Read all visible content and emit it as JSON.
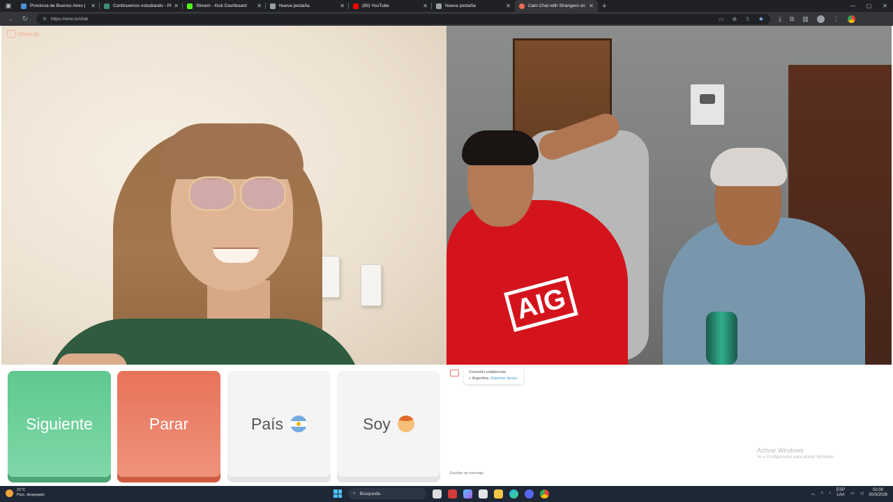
{
  "browser": {
    "tabs": [
      {
        "title": "Provincia de Buenos Aires |",
        "favicon_color": "#4a90d9",
        "active": false
      },
      {
        "title": "Continuemos estudiando - Plataf",
        "favicon_color": "#3c8d7a",
        "active": false
      },
      {
        "title": "Stream - Kick Dashboard",
        "favicon_color": "#53fc18",
        "active": false
      },
      {
        "title": "Nueva pestaña",
        "favicon_color": "#9aa0a6",
        "active": false
      },
      {
        "title": "(80) YouTube",
        "favicon_color": "#ff0000",
        "active": false
      },
      {
        "title": "Nueva pestaña",
        "favicon_color": "#9aa0a6",
        "active": false
      },
      {
        "title": "Cam Chat with Strangers on",
        "favicon_color": "#f06a54",
        "active": true
      }
    ],
    "url": "https://ome.tv/chat",
    "window_controls": [
      "—",
      "▢",
      "✕"
    ]
  },
  "site": {
    "logo_text": "Ome.tv"
  },
  "controls": {
    "next_label": "Siguiente",
    "stop_label": "Parar",
    "country_label": "País",
    "gender_label": "Soy"
  },
  "chat": {
    "system_message": {
      "line1": "Conexión establecida.",
      "country": "Argentina.",
      "report_link": "Reportar abuso."
    },
    "input_placeholder": "Escribe un mensaje",
    "watermark": {
      "line1": "Activar Windows",
      "line2": "Ve a Configuración para activar Windows."
    }
  },
  "taskbar": {
    "weather_temp": "21°C",
    "weather_desc": "Parc. despejado",
    "search_placeholder": "Búsqueda",
    "lang_line1": "ESP",
    "lang_line2": "LAA",
    "time": "02:00",
    "date": "30/3/2026"
  },
  "colors": {
    "next": "#5fc88f",
    "stop": "#e8735a",
    "accent_link": "#3f9bd6"
  }
}
